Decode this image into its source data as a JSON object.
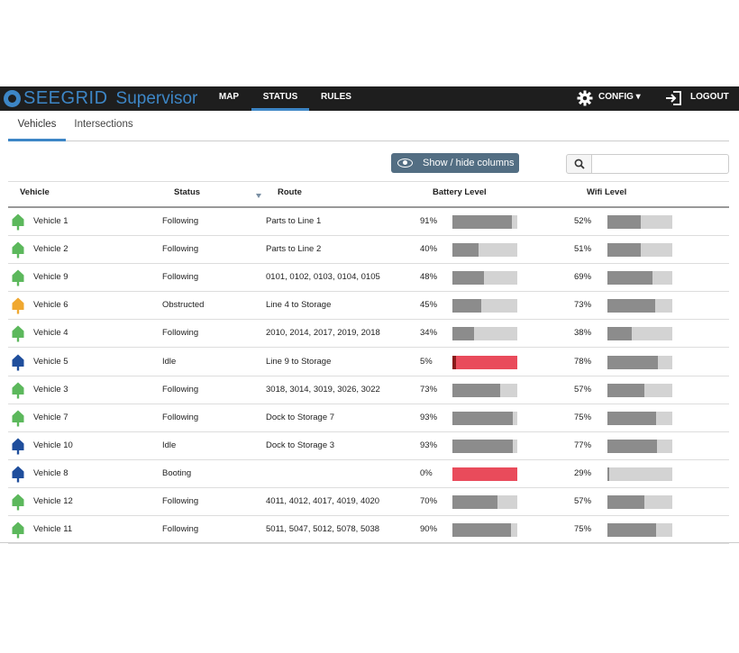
{
  "app": {
    "logo_text": "SEEGRID",
    "logo_sub": "Supervisor",
    "accent": "#3d86c6",
    "nav": [
      {
        "label": "MAP",
        "active": false
      },
      {
        "label": "STATUS",
        "active": true
      },
      {
        "label": "RULES",
        "active": false
      }
    ],
    "config_label": "CONFIG ▾",
    "config_icon": "gear-icon",
    "logout_label": "LOGOUT",
    "logout_icon": "sign-out-icon"
  },
  "subtabs": [
    {
      "label": "Vehicles",
      "active": true
    },
    {
      "label": "Intersections",
      "active": false
    }
  ],
  "toolbar": {
    "columns_button": "Show / hide columns",
    "columns_icon": "eye-icon",
    "search_icon": "search-icon",
    "search_value": ""
  },
  "table": {
    "headers": {
      "vehicle": "Vehicle",
      "status": "Status",
      "route": "Route",
      "battery": "Battery Level",
      "wifi": "Wifi Level"
    },
    "status_colors": {
      "Following": "#5cb85c",
      "Obstructed": "#f0a830",
      "Idle": "#1f4e9c",
      "Booting": "#1f4e9c"
    },
    "rows": [
      {
        "vehicle": "Vehicle 1",
        "status": "Following",
        "route": "Parts to Line 1",
        "battery": "91%",
        "battery_level": 0.91,
        "wifi": "52%",
        "wifi_level": 0.52
      },
      {
        "vehicle": "Vehicle 2",
        "status": "Following",
        "route": "Parts to Line 2",
        "battery": "40%",
        "battery_level": 0.4,
        "wifi": "51%",
        "wifi_level": 0.51
      },
      {
        "vehicle": "Vehicle 9",
        "status": "Following",
        "route": "0101, 0102, 0103, 0104, 0105",
        "battery": "48%",
        "battery_level": 0.48,
        "wifi": "69%",
        "wifi_level": 0.69
      },
      {
        "vehicle": "Vehicle 6",
        "status": "Obstructed",
        "route": "Line 4 to Storage",
        "battery": "45%",
        "battery_level": 0.45,
        "wifi": "73%",
        "wifi_level": 0.73
      },
      {
        "vehicle": "Vehicle 4",
        "status": "Following",
        "route": "2010, 2014, 2017, 2019, 2018",
        "battery": "34%",
        "battery_level": 0.34,
        "wifi": "38%",
        "wifi_level": 0.38
      },
      {
        "vehicle": "Vehicle 5",
        "status": "Idle",
        "route": "Line 9 to Storage",
        "battery": "5%",
        "battery_level": 0.05,
        "wifi": "78%",
        "wifi_level": 0.78
      },
      {
        "vehicle": "Vehicle 3",
        "status": "Following",
        "route": "3018, 3014, 3019, 3026, 3022",
        "battery": "73%",
        "battery_level": 0.73,
        "wifi": "57%",
        "wifi_level": 0.57
      },
      {
        "vehicle": "Vehicle 7",
        "status": "Following",
        "route": "Dock to Storage 7",
        "battery": "93%",
        "battery_level": 0.93,
        "wifi": "75%",
        "wifi_level": 0.75
      },
      {
        "vehicle": "Vehicle 10",
        "status": "Idle",
        "route": "Dock to Storage 3",
        "battery": "93%",
        "battery_level": 0.93,
        "wifi": "77%",
        "wifi_level": 0.77
      },
      {
        "vehicle": "Vehicle 8",
        "status": "Booting",
        "route": "",
        "battery": "0%",
        "battery_level": 0.0,
        "wifi": "29%",
        "wifi_level": 0.29
      },
      {
        "vehicle": "Vehicle 12",
        "status": "Following",
        "route": "4011, 4012, 4017, 4019, 4020",
        "battery": "70%",
        "battery_level": 0.7,
        "wifi": "57%",
        "wifi_level": 0.57
      },
      {
        "vehicle": "Vehicle 11",
        "status": "Following",
        "route": "5011, 5047, 5012, 5078, 5038",
        "battery": "90%",
        "battery_level": 0.9,
        "wifi": "75%",
        "wifi_level": 0.75
      }
    ]
  }
}
